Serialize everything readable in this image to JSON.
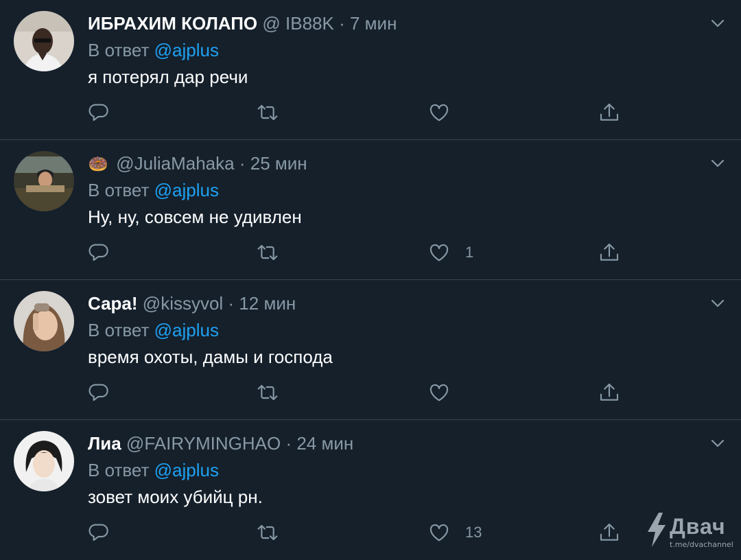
{
  "tweets": [
    {
      "name": "ИБРАХИМ КОЛАПО",
      "emoji": "",
      "handle": "@ IB88K",
      "separator": "·",
      "time": "7 мин",
      "reply_prefix": "В ответ",
      "reply_to": "@ajplus",
      "text": "я потерял дар речи",
      "likes": ""
    },
    {
      "name": "",
      "emoji": "🍩",
      "handle": "@JuliaMahaka",
      "separator": "·",
      "time": "25 мин",
      "reply_prefix": "В ответ",
      "reply_to": "@ajplus",
      "text": "Ну, ну, совсем не удивлен",
      "likes": "1"
    },
    {
      "name": "Сара!",
      "emoji": "",
      "handle": "@kissyvol",
      "separator": "·",
      "time": "12 мин",
      "reply_prefix": "В ответ",
      "reply_to": "@ajplus",
      "text": "время охоты, дамы и господа",
      "likes": ""
    },
    {
      "name": "Лиа",
      "emoji": "",
      "handle": "@FAIRYMINGHAO",
      "separator": "·",
      "time": "24 мин",
      "reply_prefix": "В ответ",
      "reply_to": "@ajplus",
      "text": "зовет моих убийц рн.",
      "likes": "13"
    }
  ],
  "icons": {
    "reply": "reply-icon",
    "retweet": "retweet-icon",
    "like": "heart-icon",
    "share": "share-icon",
    "menu": "chevron-down-icon"
  },
  "colors": {
    "background": "#15202b",
    "border": "#38444d",
    "secondary_text": "#8899a6",
    "link": "#1da1f2"
  },
  "watermark": {
    "name": "Двач",
    "url": "t.me/dvachannel"
  }
}
